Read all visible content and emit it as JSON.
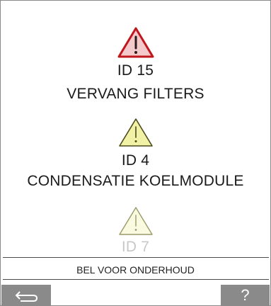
{
  "alerts": [
    {
      "severity": "error",
      "icon": "warning-triangle-red-icon",
      "id_text": "ID 15",
      "message": "VERVANG FILTERS",
      "icon_color": "#c0161d",
      "icon_fill": "#f3c9cc"
    },
    {
      "severity": "warning",
      "icon": "warning-triangle-yellow-icon",
      "id_text": "ID 4",
      "message": "CONDENSATIE KOELMODULE",
      "icon_color": "#4a4a1a",
      "icon_fill": "#f2f2a6"
    },
    {
      "severity": "warning",
      "icon": "warning-triangle-faded-icon",
      "id_text": "ID 7",
      "message": "",
      "icon_color": "#9a9a6a",
      "icon_fill": "#fafae0"
    }
  ],
  "footer": {
    "service_text": "BEL VOOR ONDERHOUD",
    "back_icon": "return-arrow-icon",
    "help_label": "?"
  },
  "colors": {
    "button_bg": "#8a8a8a",
    "button_fg": "#ffffff"
  }
}
